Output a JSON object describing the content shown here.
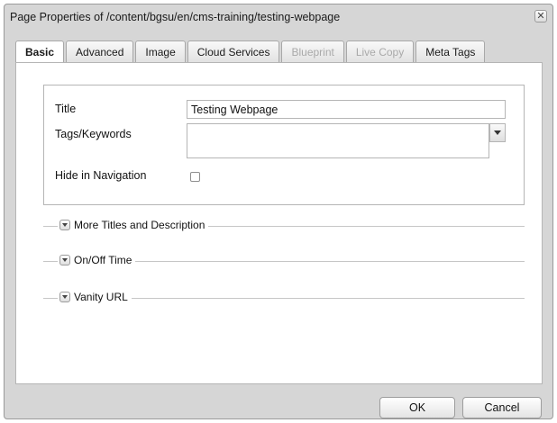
{
  "dialog": {
    "title": "Page Properties of /content/bgsu/en/cms-training/testing-webpage",
    "close_glyph": "✕"
  },
  "tabs": [
    {
      "label": "Basic",
      "state": "active"
    },
    {
      "label": "Advanced",
      "state": "enabled"
    },
    {
      "label": "Image",
      "state": "enabled"
    },
    {
      "label": "Cloud Services",
      "state": "enabled"
    },
    {
      "label": "Blueprint",
      "state": "disabled"
    },
    {
      "label": "Live Copy",
      "state": "disabled"
    },
    {
      "label": "Meta Tags",
      "state": "enabled"
    }
  ],
  "form": {
    "title_label": "Title",
    "title_value": "Testing Webpage",
    "tags_label": "Tags/Keywords",
    "tags_value": "",
    "hide_nav_label": "Hide in Navigation",
    "hide_nav_checked": false
  },
  "sections": [
    {
      "title": "More Titles and Description",
      "collapsed": true
    },
    {
      "title": "On/Off Time",
      "collapsed": true
    },
    {
      "title": "Vanity URL",
      "collapsed": true
    }
  ],
  "buttons": {
    "ok": "OK",
    "cancel": "Cancel"
  },
  "icons": {
    "close": "close-icon",
    "dropdown": "chevron-down-icon",
    "section_toggle": "chevron-down-icon"
  }
}
